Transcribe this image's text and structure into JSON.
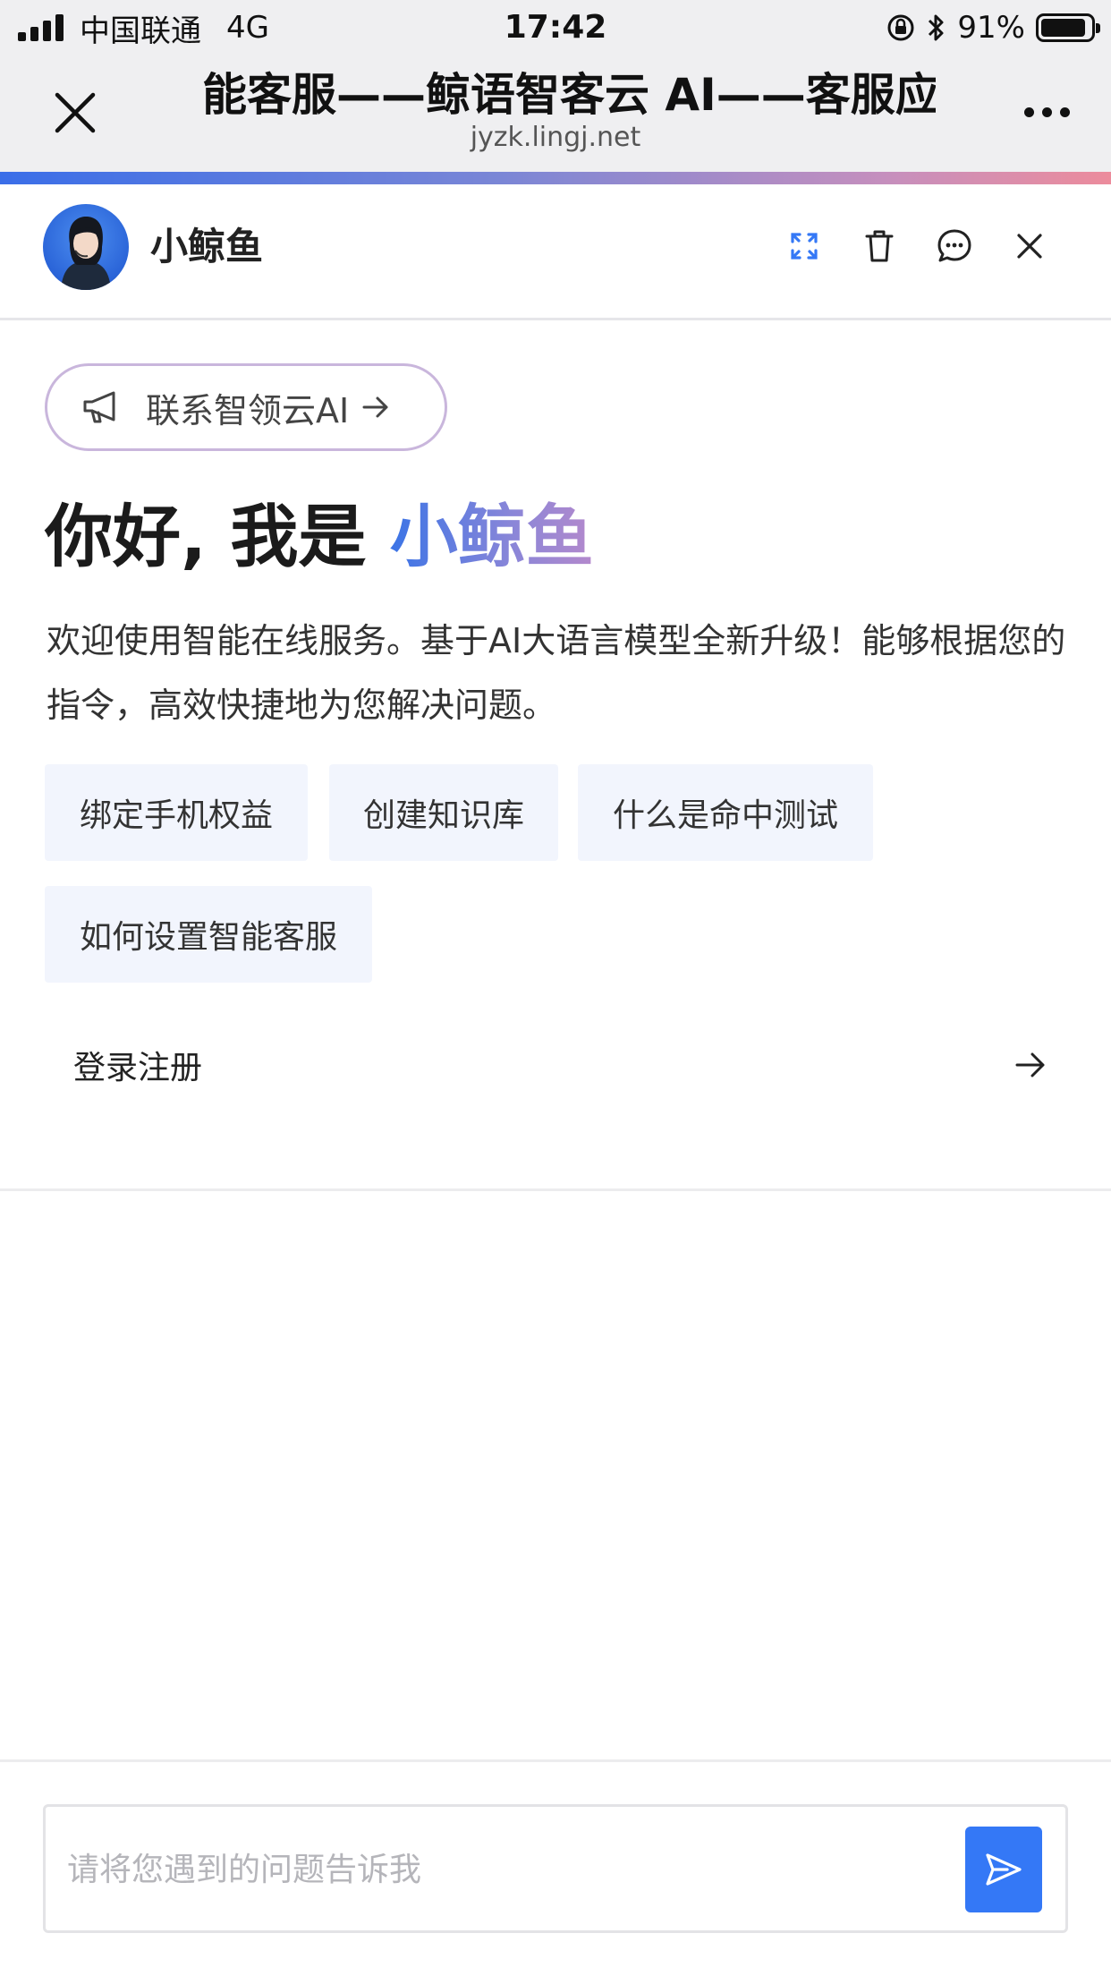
{
  "status_bar": {
    "carrier": "中国联通",
    "network": "4G",
    "time": "17:42",
    "battery_pct": "91%",
    "battery_level": 0.91
  },
  "browser": {
    "title": "能客服——鲸语智客云 AI——客服应用",
    "domain": "jyzk.lingj.net"
  },
  "chat_header": {
    "bot_name": "小鲸鱼",
    "icons": [
      "expand-icon",
      "trash-icon",
      "chat-bubble-icon",
      "close-icon"
    ]
  },
  "welcome": {
    "contact_label": "联系智领云AI",
    "greeting_prefix": "你好, 我是 ",
    "greeting_name": "小鲸鱼",
    "intro": "欢迎使用智能在线服务。基于AI大语言模型全新升级！能够根据您的指令，高效快捷地为您解决问题。",
    "suggestions": [
      "绑定手机权益",
      "创建知识库",
      "什么是命中测试",
      "如何设置智能客服"
    ],
    "login_label": "登录注册"
  },
  "input": {
    "placeholder": "请将您遇到的问题告诉我",
    "value": ""
  },
  "colors": {
    "accent": "#3478f6",
    "chip_bg": "#f2f5fd",
    "pill_border": "#c9b6dc"
  }
}
